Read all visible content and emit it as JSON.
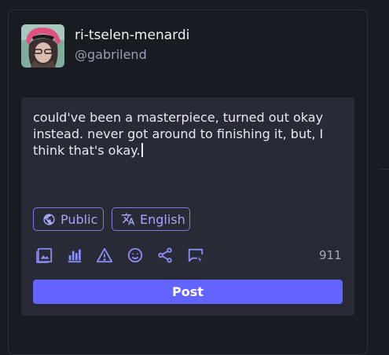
{
  "profile": {
    "display_name": "ri-tselen-menardi",
    "handle": "@gabrilend"
  },
  "composer": {
    "text": "could've been a masterpiece, turned out okay instead. never got around to finishing it, but, I think that's okay.",
    "visibility": {
      "label": "Public",
      "icon": "globe-icon"
    },
    "language": {
      "label": "English",
      "icon": "translate-icon"
    },
    "toolbar": [
      {
        "name": "add-media",
        "icon": "image-icon"
      },
      {
        "name": "add-poll",
        "icon": "poll-chart-icon"
      },
      {
        "name": "content-warning",
        "icon": "warning-icon"
      },
      {
        "name": "emoji",
        "icon": "smiley-icon"
      },
      {
        "name": "share",
        "icon": "share-icon"
      },
      {
        "name": "quote-post",
        "icon": "comment-flash-icon"
      }
    ],
    "char_count": "911",
    "post_label": "Post"
  },
  "colors": {
    "background": "#191b22",
    "composer_bg": "#282a36",
    "accent": "#6364ff",
    "accent_text": "#a3a6f5"
  }
}
